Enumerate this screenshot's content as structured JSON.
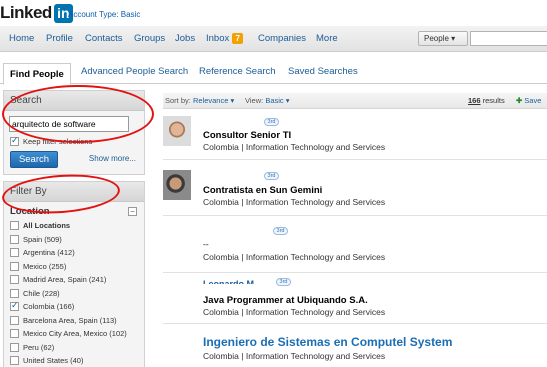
{
  "header": {
    "logo_word": "Linked",
    "logo_in": "in",
    "account_type": "Account Type: Basic"
  },
  "nav": {
    "items": [
      "Home",
      "Profile",
      "Contacts",
      "Groups",
      "Jobs",
      "Inbox",
      "Companies",
      "More"
    ],
    "inbox_count": "7",
    "search_scope": "People ▾"
  },
  "tabs": [
    "Find People",
    "Advanced People Search",
    "Reference Search",
    "Saved Searches"
  ],
  "search_panel": {
    "title": "Search",
    "keywords_value": "arquitecto de software",
    "keep_filters_label": "Keep filter selections",
    "keep_filters_checked": true,
    "search_button": "Search",
    "show_more": "Show more..."
  },
  "filter_panel": {
    "title": "Filter By",
    "location_heading": "Location",
    "collapse_symbol": "−",
    "locations": [
      {
        "label": "All Locations",
        "checked": false,
        "bold": true
      },
      {
        "label": "Spain (509)",
        "checked": false
      },
      {
        "label": "Argentina (412)",
        "checked": false
      },
      {
        "label": "Mexico (255)",
        "checked": false
      },
      {
        "label": "Madrid Area, Spain (241)",
        "checked": false
      },
      {
        "label": "Chile (228)",
        "checked": false
      },
      {
        "label": "Colombia (166)",
        "checked": true
      },
      {
        "label": "Barcelona Area, Spain (113)",
        "checked": false
      },
      {
        "label": "Mexico City Area, Mexico (102)",
        "checked": false
      },
      {
        "label": "Peru (62)",
        "checked": false
      },
      {
        "label": "United States (40)",
        "checked": false
      }
    ]
  },
  "sortbar": {
    "sort_prefix": "Sort by:",
    "sort_value": "Relevance ▾",
    "view_prefix": "View:",
    "view_value": "Basic ▾",
    "results_count": "166",
    "results_suffix": "results",
    "save_label": "Save"
  },
  "results": [
    {
      "degree": "3rd",
      "title": "Consultor Senior TI",
      "subtitle": "Colombia | Information Technology and Services"
    },
    {
      "degree": "3rd",
      "title": "Contratista en Sun Gemini",
      "subtitle": "Colombia | Information Technology and Services"
    },
    {
      "degree": "3rd",
      "title": "--",
      "subtitle": "Colombia | Information Technology and Services"
    },
    {
      "degree": "3rd",
      "name": "Leonardo M.",
      "title": "Java Programmer at Ubiquando S.A.",
      "subtitle": "Colombia | Information Technology and Services"
    },
    {
      "title": "Ingeniero de Sistemas en Computel System",
      "subtitle": "Colombia | Information Technology and Services"
    }
  ],
  "colors": {
    "brand_blue": "#0073b1",
    "link_blue": "#1b5d98",
    "annotation_red": "#e31212",
    "inbox_badge": "#f2a100"
  }
}
